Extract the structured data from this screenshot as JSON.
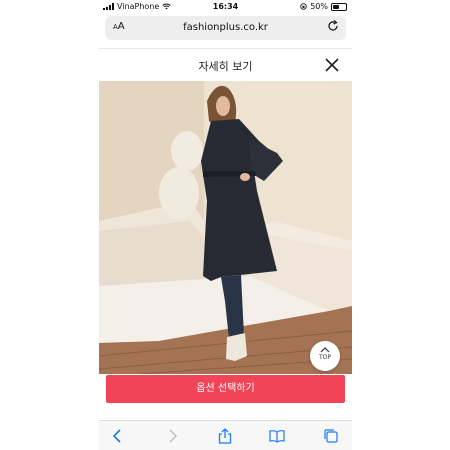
{
  "status_bar": {
    "carrier": "VinaPhone",
    "time": "16:34",
    "battery_percent": "50%",
    "battery_level": 0.5
  },
  "browser": {
    "text_size_label": "AA",
    "url": "fashionplus.co.kr"
  },
  "sheet": {
    "title": "자세히 보기"
  },
  "scroll_top": {
    "label": "TOP"
  },
  "option_button": {
    "label": "옵션 선택하기"
  },
  "colors": {
    "accent": "#f14456",
    "ios_blue": "#1b7cf6"
  },
  "icons": {
    "reload": "reload-icon",
    "close": "close-icon",
    "back": "chevron-left-icon",
    "forward": "chevron-right-icon",
    "share": "share-icon",
    "bookmarks": "book-icon",
    "tabs": "tabs-icon"
  }
}
